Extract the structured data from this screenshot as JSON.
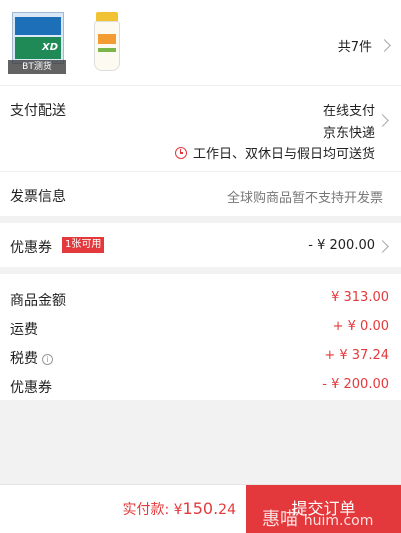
{
  "products": {
    "item1_tag": "BT测货",
    "item1_brand": "XD",
    "count_label": "共7件"
  },
  "delivery": {
    "label": "支付配送",
    "payment": "在线支付",
    "shipping": "京东快递",
    "schedule": "工作日、双休日与假日均可送货"
  },
  "invoice": {
    "label": "发票信息",
    "value": "全球购商品暂不支持开发票"
  },
  "coupon": {
    "label": "优惠券",
    "badge": "1张可用",
    "value": "- ¥ 200.00"
  },
  "amounts": [
    {
      "label": "商品金额",
      "value": "¥ 313.00"
    },
    {
      "label": "运费",
      "value": "+ ¥ 0.00"
    },
    {
      "label": "税费",
      "value": "+ ¥ 37.24"
    },
    {
      "label": "优惠券",
      "value": "- ¥ 200.00"
    }
  ],
  "footer": {
    "paid_label": "实付款: ¥",
    "paid_int": "150.",
    "paid_dec": "24",
    "submit_label": "提交订单",
    "watermark_cn": "惠喵",
    "watermark_url": "huim.com"
  },
  "colors": {
    "accent": "#e4393c",
    "background": "#f2f2f2"
  }
}
